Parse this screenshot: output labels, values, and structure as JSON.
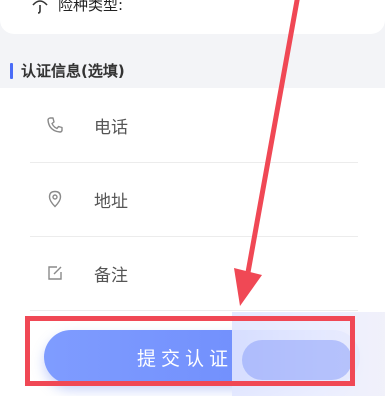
{
  "insurance": {
    "label": "险种类型:"
  },
  "section": {
    "title": "认证信息(选填)"
  },
  "form": {
    "fields": [
      {
        "label": "电话",
        "icon": "phone-icon"
      },
      {
        "label": "地址",
        "icon": "location-pin-icon"
      },
      {
        "label": "备注",
        "icon": "edit-note-icon"
      }
    ]
  },
  "submit": {
    "label": "提交认证"
  },
  "colors": {
    "accent": "#4a6cf7",
    "button_gradient_start": "#7f9cff",
    "button_gradient_end": "#6a89fb",
    "annotation_red": "#f04855"
  }
}
